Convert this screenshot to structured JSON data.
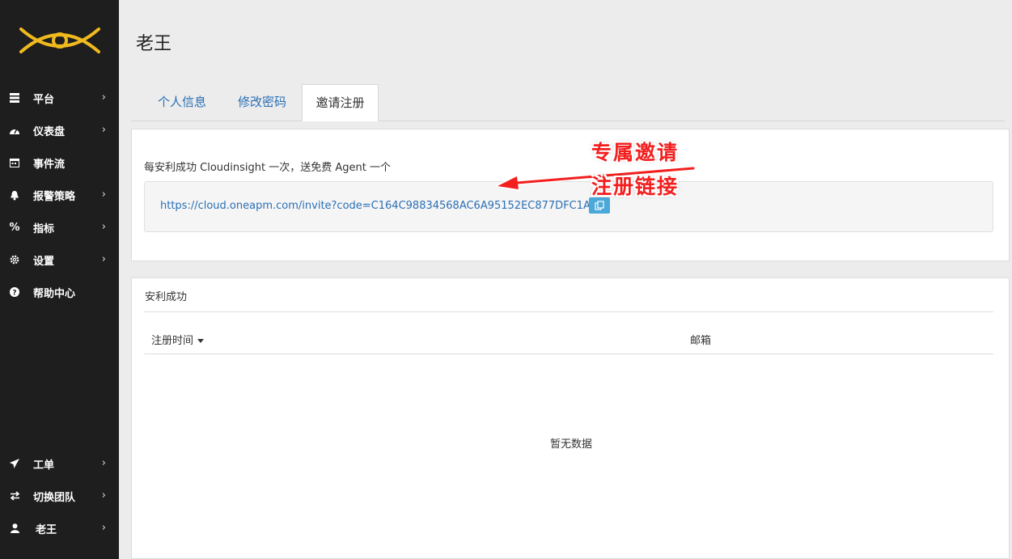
{
  "sidebar": {
    "top_items": [
      {
        "label": "平台",
        "icon": "server-icon"
      },
      {
        "label": "仪表盘",
        "icon": "dashboard-icon"
      },
      {
        "label": "事件流",
        "icon": "calendar-icon"
      },
      {
        "label": "报警策略",
        "icon": "bell-icon"
      },
      {
        "label": "指标",
        "icon": "percent-icon"
      },
      {
        "label": "设置",
        "icon": "gear-icon"
      },
      {
        "label": "帮助中心",
        "icon": "question-icon"
      }
    ],
    "bottom_items": [
      {
        "label": "工单",
        "icon": "paper-plane-icon"
      },
      {
        "label": "切换团队",
        "icon": "exchange-icon"
      },
      {
        "label": "老王",
        "icon": "user-icon"
      }
    ]
  },
  "header": {
    "title": "老王"
  },
  "tabs": [
    {
      "label": "个人信息",
      "active": false
    },
    {
      "label": "修改密码",
      "active": false
    },
    {
      "label": "邀请注册",
      "active": true
    }
  ],
  "invite": {
    "description": "每安利成功 Cloudinsight 一次，送免费 Agent 一个",
    "link": "https://cloud.oneapm.com/invite?code=C164C98834568AC6A95152EC877DFC1A"
  },
  "annotation": {
    "line1": "专属邀请",
    "line2": "注册链接"
  },
  "success": {
    "title": "安利成功",
    "columns": [
      "注册时间",
      "邮箱"
    ],
    "empty_text": "暂无数据"
  },
  "colors": {
    "accent": "#2a6fb5",
    "annotation": "#f31f1f",
    "sidebar_bg": "#1e1e1e",
    "logo": "#f0b91e"
  }
}
